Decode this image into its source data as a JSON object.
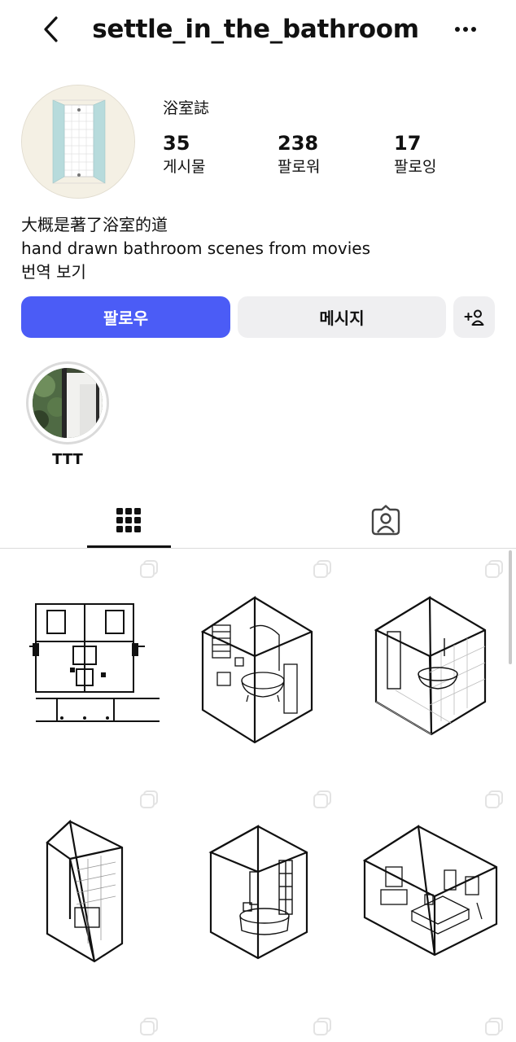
{
  "header": {
    "username": "settle_in_the_bathroom",
    "back_icon": "chevron-left-icon",
    "more_icon": "more-horizontal-icon"
  },
  "profile": {
    "display_name": "浴室誌",
    "stats": [
      {
        "value": "35",
        "label": "게시물"
      },
      {
        "value": "238",
        "label": "팔로워"
      },
      {
        "value": "17",
        "label": "팔로잉"
      }
    ],
    "bio_lines": [
      "大概是著了浴室的道",
      "hand drawn bathroom scenes from movies",
      "번역 보기"
    ]
  },
  "actions": {
    "follow_label": "팔로우",
    "message_label": "메시지",
    "add_person_icon": "add-person-icon"
  },
  "highlights": [
    {
      "label": "TTT"
    }
  ],
  "tabs": [
    {
      "name": "posts",
      "icon": "grid-icon",
      "active": true
    },
    {
      "name": "tagged",
      "icon": "tagged-person-icon",
      "active": false
    }
  ],
  "posts": [
    {
      "subject": "floor-plan"
    },
    {
      "subject": "clawfoot-tub-shower-curtain"
    },
    {
      "subject": "tub-tiled-wall-open-door"
    },
    {
      "subject": "narrow-tiled-shower"
    },
    {
      "subject": "tub-window-frame"
    },
    {
      "subject": "tub-vanity-toilet"
    }
  ],
  "colors": {
    "accent": "#4b5cf6",
    "secondary_button": "#efeff1",
    "divider": "#dbdbdb"
  }
}
